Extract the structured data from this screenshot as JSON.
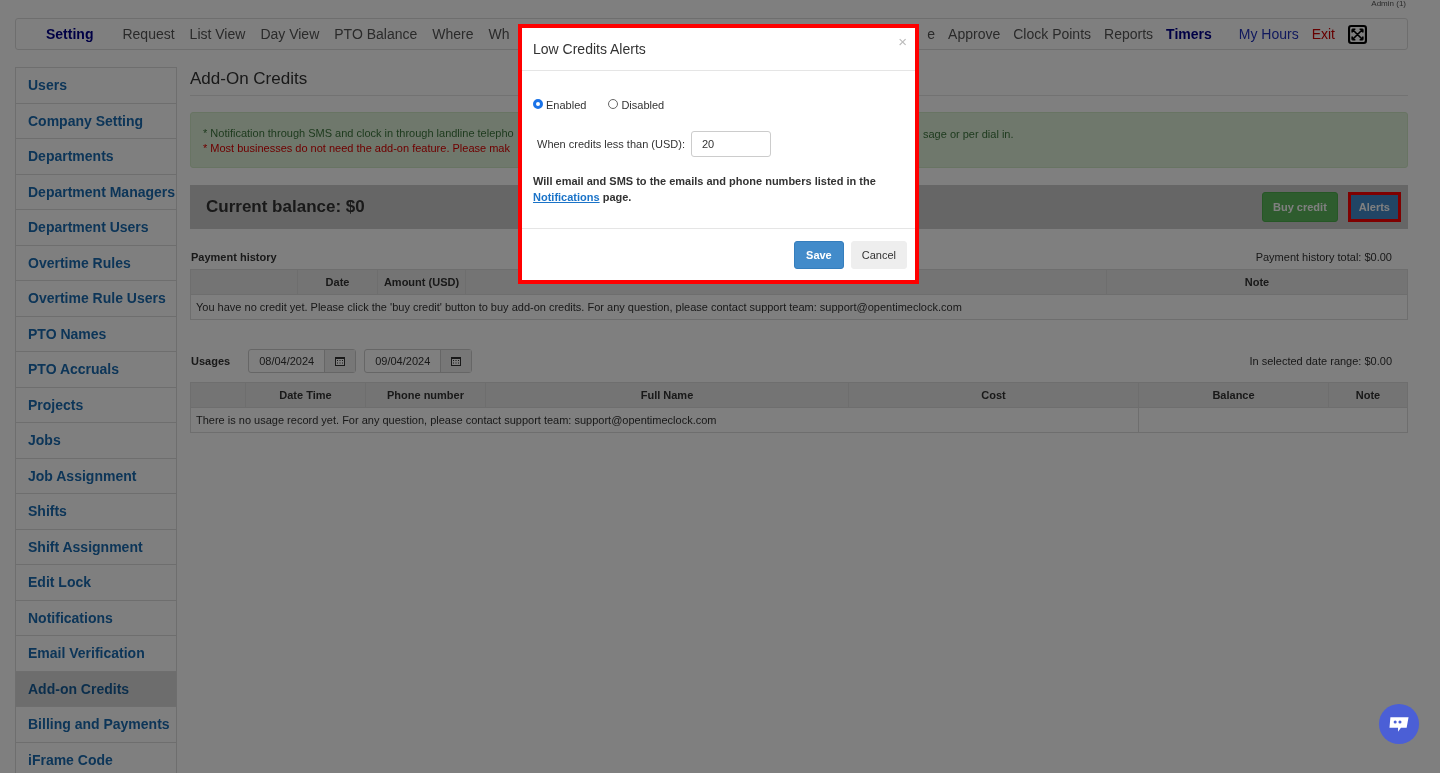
{
  "header": {
    "user_label": "Admin (1)",
    "nav_left": [
      {
        "label": "Setting",
        "kind": "current"
      },
      {
        "label": "Request",
        "kind": "link"
      },
      {
        "label": "List View",
        "kind": "link"
      },
      {
        "label": "Day View",
        "kind": "link"
      },
      {
        "label": "PTO Balance",
        "kind": "link"
      },
      {
        "label": "Where",
        "kind": "link"
      },
      {
        "label": "Wh",
        "kind": "link"
      }
    ],
    "nav_right": [
      {
        "label": "e",
        "kind": "link"
      },
      {
        "label": "Approve",
        "kind": "link"
      },
      {
        "label": "Clock Points",
        "kind": "link"
      },
      {
        "label": "Reports",
        "kind": "link"
      },
      {
        "label": "Timers",
        "kind": "current"
      },
      {
        "label": "My Hours",
        "kind": "special"
      },
      {
        "label": "Exit",
        "kind": "exit"
      }
    ]
  },
  "sidebar": {
    "items": [
      {
        "label": "Users",
        "selected": false
      },
      {
        "label": "Company Setting",
        "selected": false
      },
      {
        "label": "Departments",
        "selected": false
      },
      {
        "label": "Department Managers",
        "selected": false
      },
      {
        "label": "Department Users",
        "selected": false
      },
      {
        "label": "Overtime Rules",
        "selected": false
      },
      {
        "label": "Overtime Rule Users",
        "selected": false
      },
      {
        "label": "PTO Names",
        "selected": false
      },
      {
        "label": "PTO Accruals",
        "selected": false
      },
      {
        "label": "Projects",
        "selected": false
      },
      {
        "label": "Jobs",
        "selected": false
      },
      {
        "label": "Job Assignment",
        "selected": false
      },
      {
        "label": "Shifts",
        "selected": false
      },
      {
        "label": "Shift Assignment",
        "selected": false
      },
      {
        "label": "Edit Lock",
        "selected": false
      },
      {
        "label": "Notifications",
        "selected": false
      },
      {
        "label": "Email Verification",
        "selected": false
      },
      {
        "label": "Add-on Credits",
        "selected": true
      },
      {
        "label": "Billing and Payments",
        "selected": false
      },
      {
        "label": "iFrame Code",
        "selected": false
      }
    ]
  },
  "page_title": "Add-On Credits",
  "notice": {
    "line_1_start": "* Notification through SMS and clock in through landline telepho",
    "line_1_end": "sage or per dial in.",
    "line_2_start": "* Most businesses do not need the add-on feature. Please mak"
  },
  "balance": {
    "label": "Current balance: $0",
    "buy_button": "Buy credit",
    "alerts_button": "Alerts"
  },
  "payment_history": {
    "title": "Payment history",
    "total": "Payment history total: $0.00",
    "columns": [
      "Date",
      "Amount (USD)",
      "Note"
    ],
    "empty_message": "You have no credit yet. Please click the 'buy credit' button to buy add-on credits. For any question, please contact support team: support@opentimeclock.com"
  },
  "usages": {
    "title": "Usages",
    "from_date": "08/04/2024",
    "to_date": "09/04/2024",
    "range_total": "In selected date range: $0.00",
    "columns": [
      "Date Time",
      "Phone number",
      "Full Name",
      "Cost",
      "Balance",
      "Note"
    ],
    "empty_message": "There is no usage record yet. For any question, please contact support team: support@opentimeclock.com"
  },
  "modal": {
    "title": "Low Credits Alerts",
    "close": "×",
    "options": [
      {
        "label": "Enabled",
        "selected": true
      },
      {
        "label": "Disabled",
        "selected": false
      }
    ],
    "threshold_label": "When credits less than (USD):",
    "threshold_value": "20",
    "info_text": "Will email and SMS to the emails and phone numbers listed in the",
    "info_link": "Notifications",
    "info_end": "page.",
    "save": "Save",
    "cancel": "Cancel"
  }
}
